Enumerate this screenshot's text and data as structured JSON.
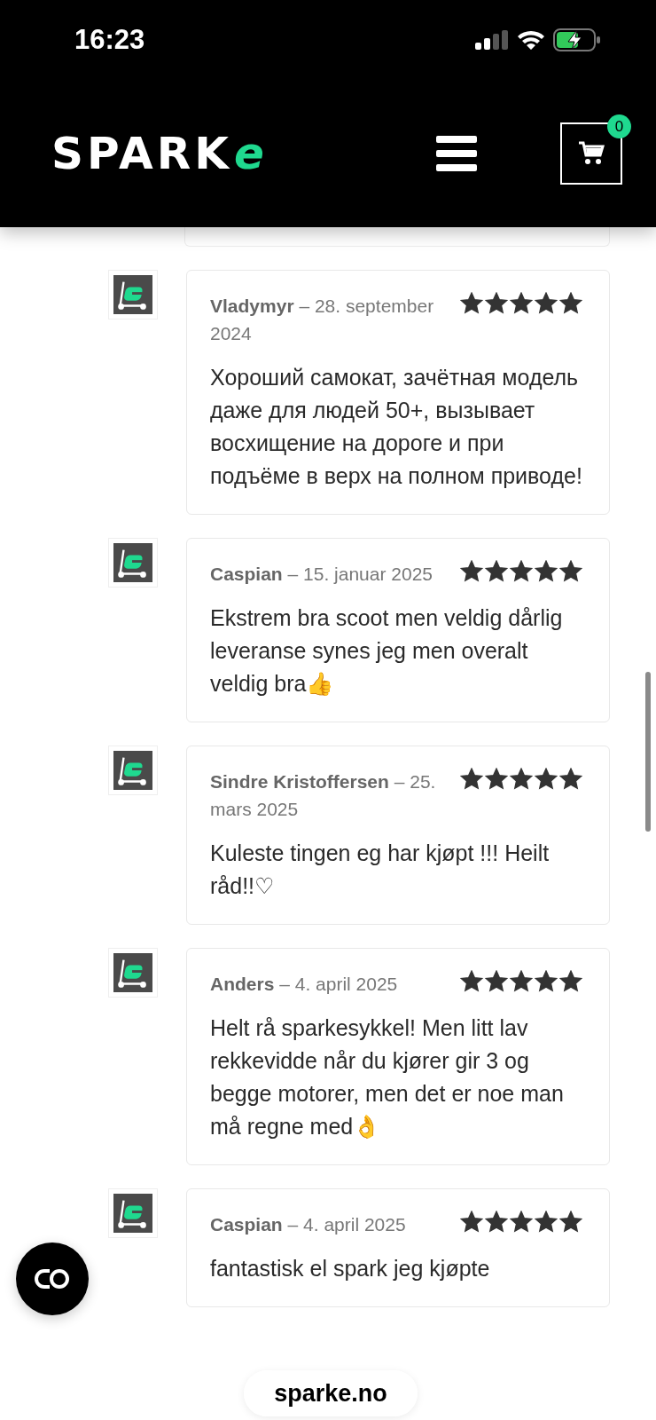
{
  "status_bar": {
    "time": "16:23"
  },
  "header": {
    "logo": {
      "text": "SPARK",
      "accent": "e"
    },
    "cart_count": "0"
  },
  "reviews": [
    {
      "author": "Vladymyr",
      "date": "– 28. september 2024",
      "stars": 5,
      "text": "Хороший самокат, зачётная модель даже для людей 50+, вызывает восхищение на дороге и при подъёме в верх на полном приводе!"
    },
    {
      "author": "Caspian",
      "date": "– 15. januar 2025",
      "stars": 5,
      "text": "Ekstrem bra scoot men veldig dårlig leveranse synes jeg men overalt veldig bra👍"
    },
    {
      "author": "Sindre Kristoffersen",
      "date": "– 25. mars 2025",
      "stars": 5,
      "text": "Kuleste tingen eg har kjøpt !!! Heilt råd!!♡"
    },
    {
      "author": "Anders",
      "date": "– 4. april 2025",
      "stars": 5,
      "text": "Helt rå sparkesykkel! Men litt lav rekkevidde når du kjører gir 3 og begge motorer, men det er noe man må regne med👌"
    },
    {
      "author": "Caspian",
      "date": "– 4. april 2025",
      "stars": 5,
      "text": "fantastisk el spark jeg kjøpte"
    }
  ],
  "url_bar": {
    "domain": "sparke.no"
  }
}
